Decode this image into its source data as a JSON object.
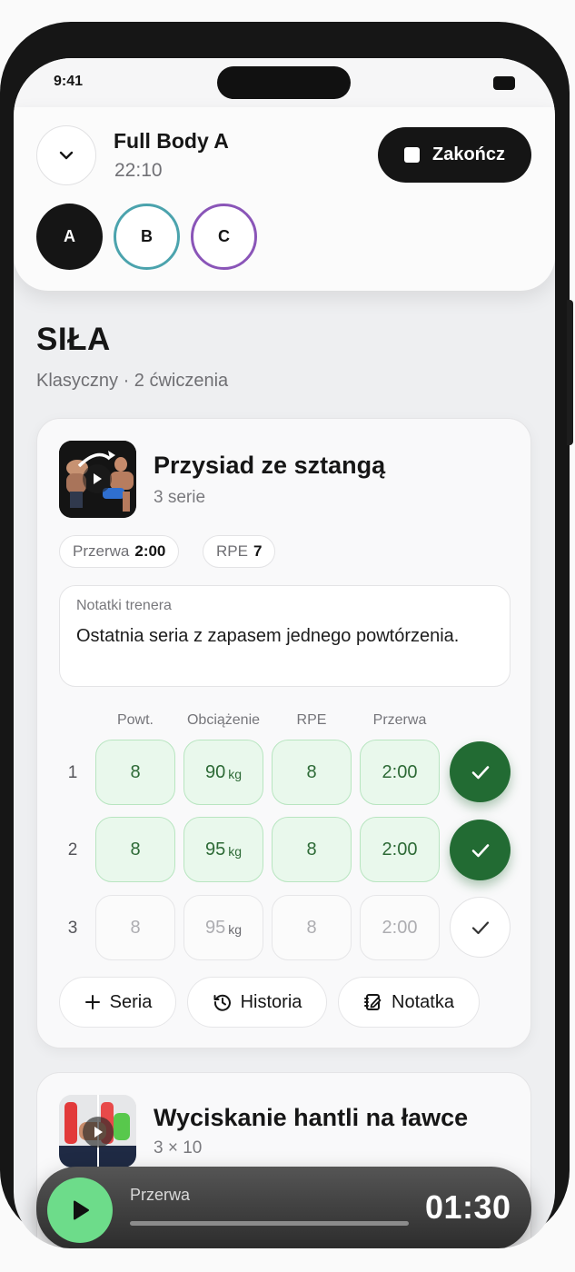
{
  "status_bar": {
    "time": "9:41"
  },
  "header": {
    "workout_title": "Full Body A",
    "workout_timer": "22:10",
    "finish_label": "Zakończ",
    "variants": [
      "A",
      "B",
      "C"
    ],
    "active_variant": "A"
  },
  "section": {
    "title": "SIŁA",
    "subtitle": "Klasyczny · 2 ćwiczenia"
  },
  "exercise1": {
    "name": "Przysiad ze sztangą",
    "sets_label": "3 serie",
    "rest_label": "Przerwa",
    "rest_value": "2:00",
    "rpe_label": "RPE",
    "rpe_value": "7",
    "notes_label": "Notatki trenera",
    "notes_text": "Ostatnia seria z zapasem jednego powtórzenia.",
    "columns": [
      "Powt.",
      "Obciążenie",
      "RPE",
      "Przerwa"
    ],
    "sets": [
      {
        "num": "1",
        "reps": "8",
        "weight": "90",
        "unit": "kg",
        "rpe": "8",
        "rest": "2:00",
        "done": true
      },
      {
        "num": "2",
        "reps": "8",
        "weight": "95",
        "unit": "kg",
        "rpe": "8",
        "rest": "2:00",
        "done": true
      },
      {
        "num": "3",
        "reps": "8",
        "weight": "95",
        "unit": "kg",
        "rpe": "8",
        "rest": "2:00",
        "done": false
      }
    ],
    "actions": {
      "add_set": "Seria",
      "history": "Historia",
      "note": "Notatka"
    }
  },
  "exercise2": {
    "name": "Wyciskanie hantli na ławce",
    "sets_label": "3 × 10"
  },
  "rest_timer": {
    "label": "Przerwa",
    "time": "01:30",
    "progress": 0
  },
  "colors": {
    "accent_green": "#226b33",
    "done_cell_bg": "#e9f8ec",
    "variant_b": "#4ba3ad",
    "variant_c": "#8a55b8",
    "timer_play": "#6ddc8a"
  }
}
